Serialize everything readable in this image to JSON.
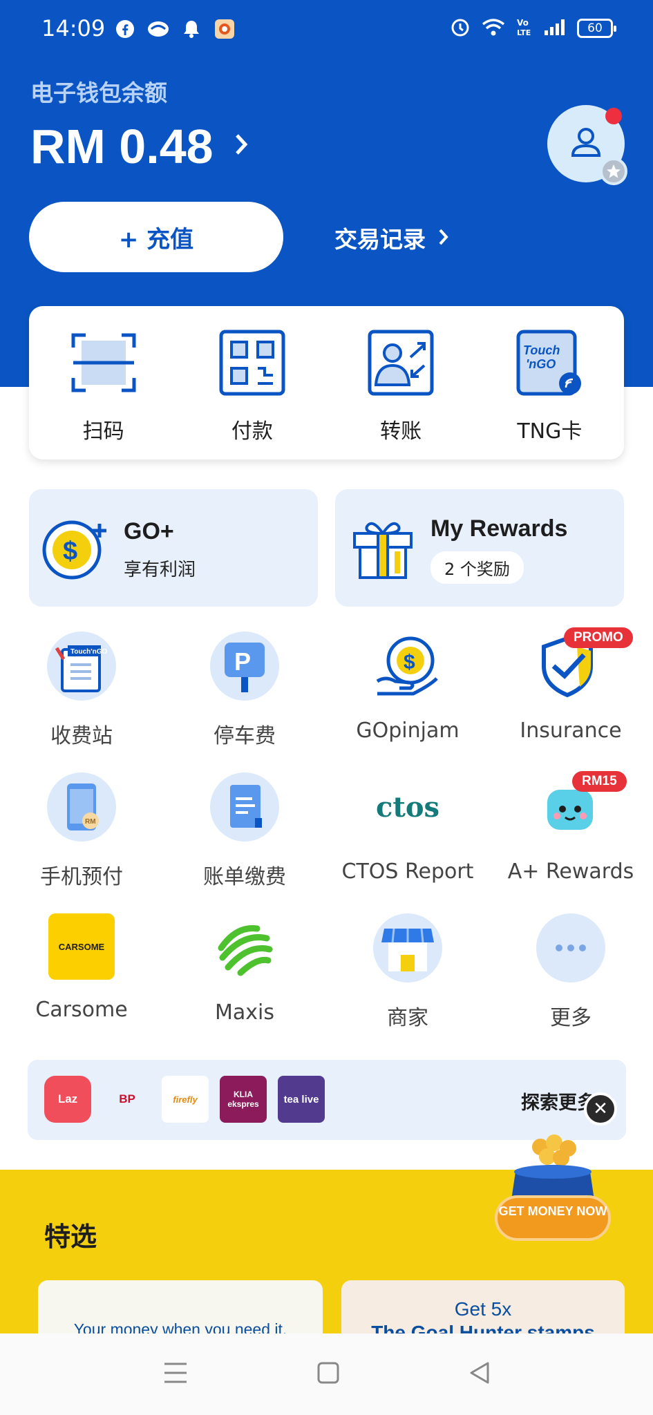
{
  "status_bar": {
    "time": "14:09",
    "battery": "60"
  },
  "header": {
    "wallet_label": "电子钱包余额",
    "balance": "RM 0.48",
    "reload_label": "+ 充值",
    "transactions_label": "交易记录"
  },
  "quick_actions": [
    {
      "label": "扫码",
      "icon": "scan-icon"
    },
    {
      "label": "付款",
      "icon": "qr-pay-icon"
    },
    {
      "label": "转账",
      "icon": "transfer-icon"
    },
    {
      "label": "TNG卡",
      "icon": "tng-card-icon"
    }
  ],
  "cards": {
    "go_plus": {
      "title": "GO+",
      "subtitle": "享有利润"
    },
    "rewards": {
      "title": "My Rewards",
      "pill": "2 个奖励"
    }
  },
  "services": [
    {
      "label": "收费站",
      "icon": "toll-icon"
    },
    {
      "label": "停车费",
      "icon": "parking-icon"
    },
    {
      "label": "GOpinjam",
      "icon": "loan-icon"
    },
    {
      "label": "Insurance",
      "icon": "insurance-icon",
      "badge": "PROMO"
    },
    {
      "label": "手机预付",
      "icon": "prepaid-icon"
    },
    {
      "label": "账单缴费",
      "icon": "bill-icon"
    },
    {
      "label": "CTOS Report",
      "icon": "ctos-icon",
      "logo_text": "ctos"
    },
    {
      "label": "A+ Rewards",
      "icon": "aplus-icon",
      "badge": "RM15"
    },
    {
      "label": "Carsome",
      "icon": "carsome-icon",
      "logo_text": "CARSOME"
    },
    {
      "label": "Maxis",
      "icon": "maxis-icon"
    },
    {
      "label": "商家",
      "icon": "merchant-icon"
    },
    {
      "label": "更多",
      "icon": "more-icon"
    }
  ],
  "partners": {
    "logos": [
      "Laz",
      "BP",
      "firefly",
      "KLIA ekspres",
      "tea live"
    ],
    "explore_label": "探索更多"
  },
  "promo": {
    "money_button": "GET MONEY NOW"
  },
  "featured": {
    "title": "特选",
    "card_a": "Your money when you need it.",
    "card_b_line1": "Get 5x",
    "card_b_line2": "The Goal Hunter stamps"
  },
  "colors": {
    "brand_blue": "#0a55c3",
    "featured_yellow": "#f4cf0d",
    "badge_red": "#e8323a"
  }
}
